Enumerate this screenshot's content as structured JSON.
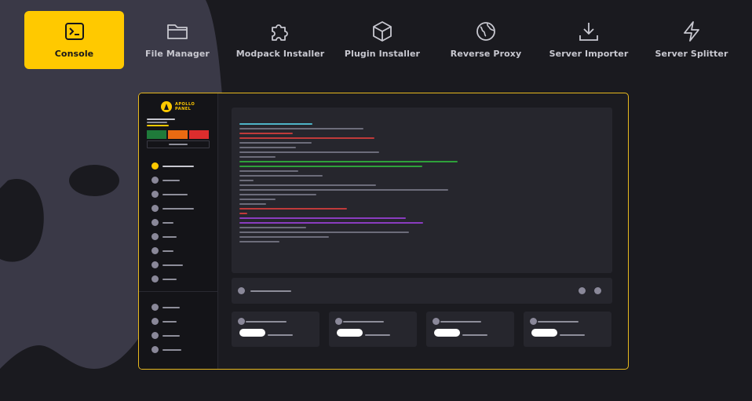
{
  "colors": {
    "accent": "#ffc900",
    "background": "#1a1a1f",
    "ghost": "#3a3947",
    "panel_border": "#e8b91e",
    "console_bg": "#26262d",
    "green": "#1f7a3a",
    "orange": "#ea6a12",
    "red": "#dc2d2d",
    "log_cyan": "#4fb4c8",
    "log_gray": "#6c6c7a",
    "log_red": "#c03a3a",
    "log_green": "#2ea03a",
    "log_purple": "#8a3cc0"
  },
  "tabs": [
    {
      "label": "Console",
      "icon": "terminal-icon",
      "active": true
    },
    {
      "label": "File Manager",
      "icon": "folder-icon",
      "active": false
    },
    {
      "label": "Modpack Installer",
      "icon": "puzzle-icon",
      "active": false
    },
    {
      "label": "Plugin Installer",
      "icon": "box-icon",
      "active": false
    },
    {
      "label": "Reverse Proxy",
      "icon": "globe-icon",
      "active": false
    },
    {
      "label": "Server Importer",
      "icon": "download-icon",
      "active": false
    },
    {
      "label": "Server Splitter",
      "icon": "lightning-icon",
      "active": false
    }
  ],
  "preview": {
    "logo_line1": "APOLLO",
    "logo_line2": "PANEL",
    "power_buttons": [
      "green",
      "orange",
      "red"
    ]
  }
}
